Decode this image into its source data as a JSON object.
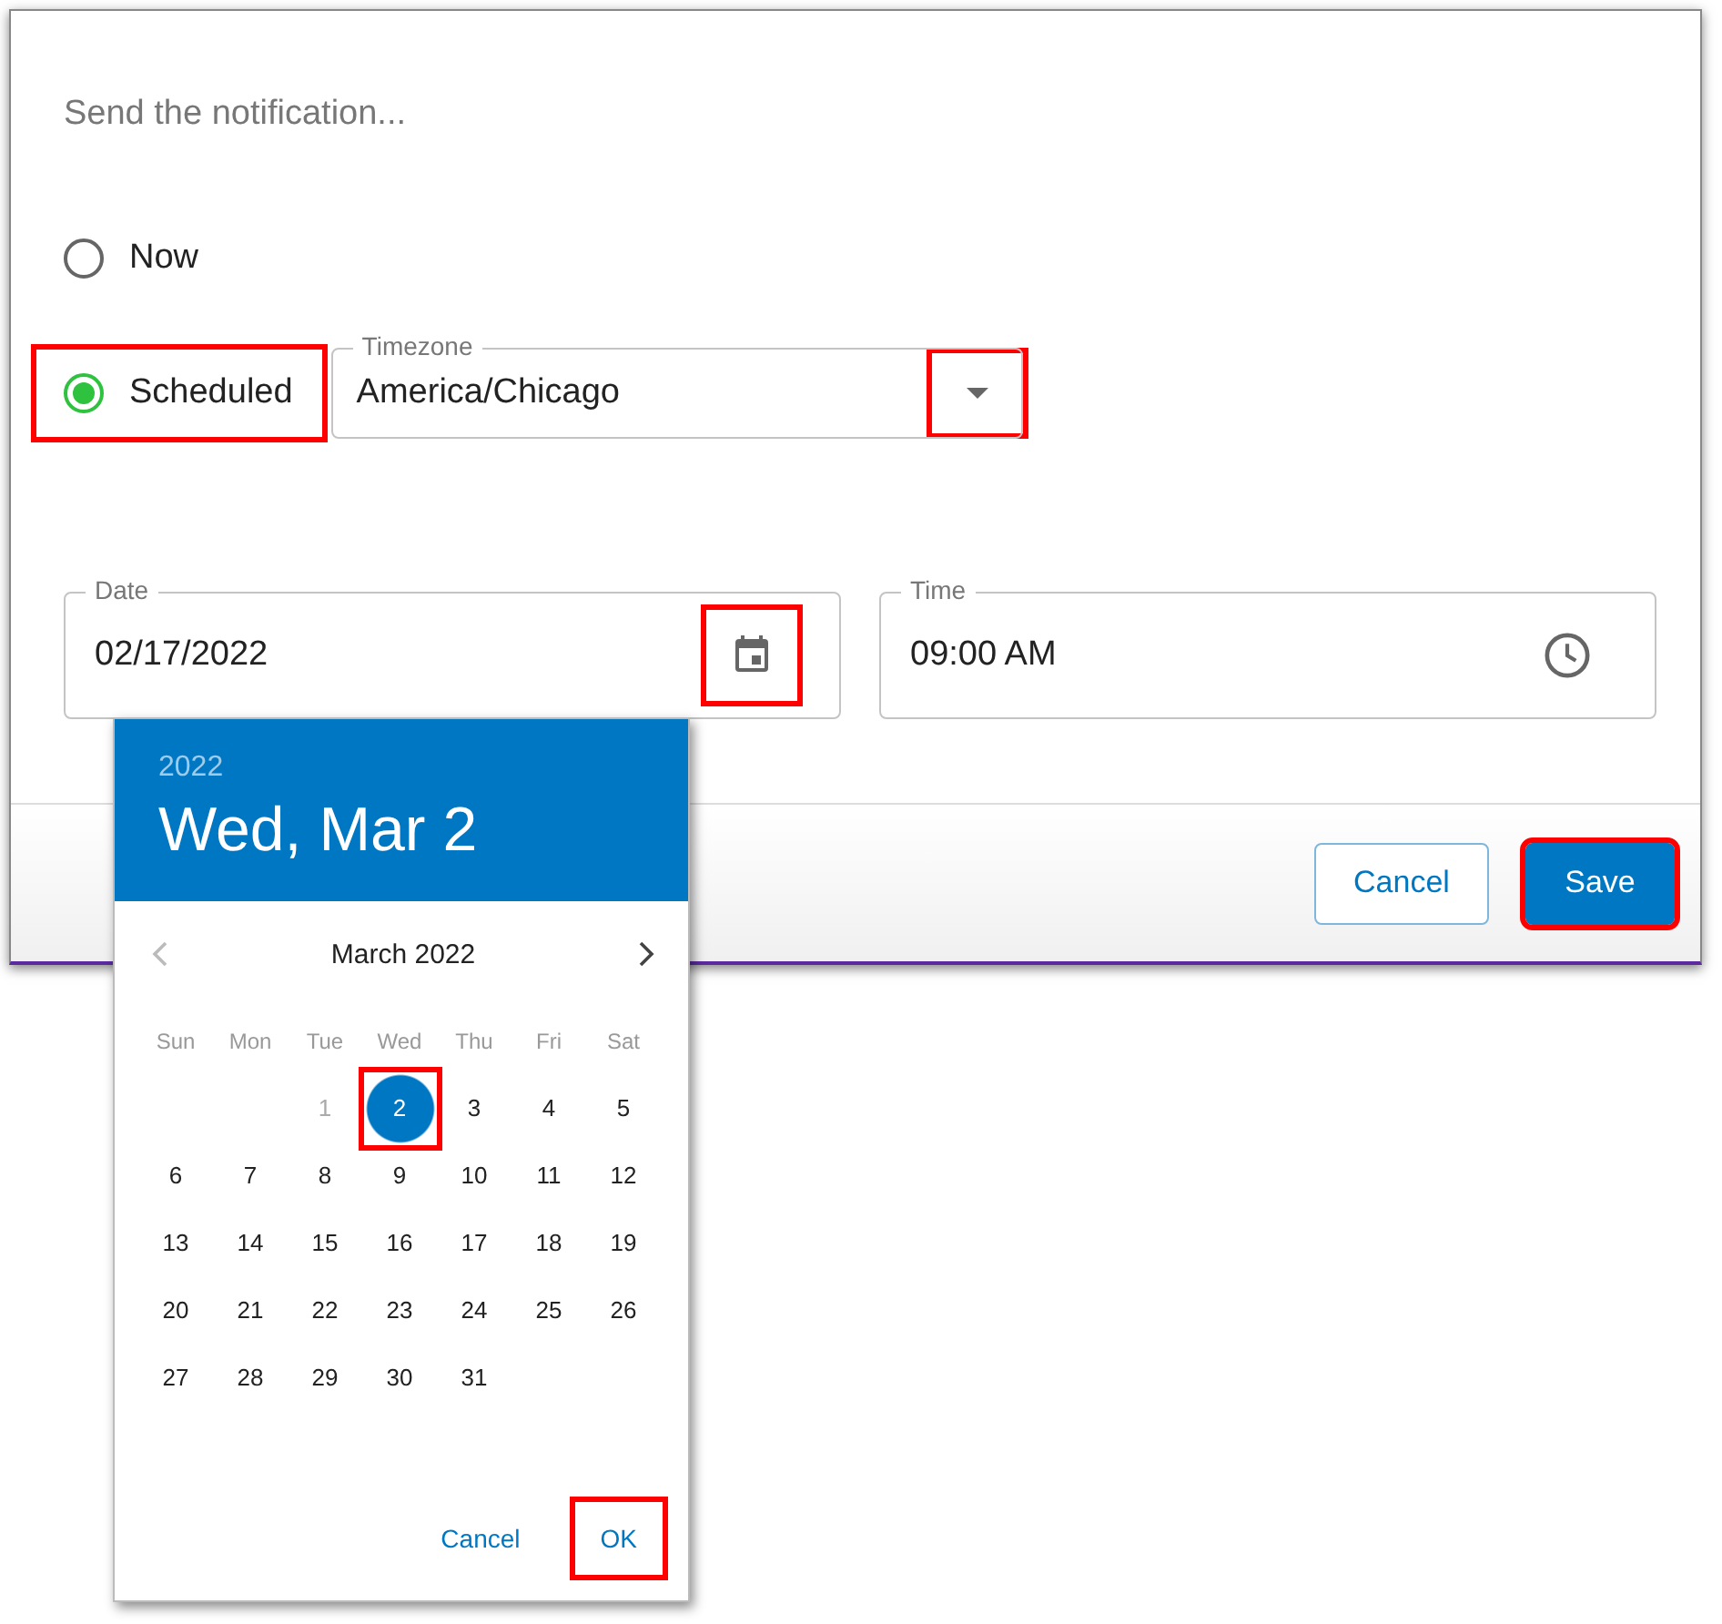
{
  "dialog": {
    "prompt": "Send the notification...",
    "options": [
      {
        "label": "Now",
        "selected": false,
        "highlighted": false
      },
      {
        "label": "Scheduled",
        "selected": true,
        "highlighted": true
      }
    ],
    "timezone": {
      "label": "Timezone",
      "value": "America/Chicago",
      "dropdown_highlighted": true
    },
    "date": {
      "label": "Date",
      "value": "02/17/2022",
      "icon_highlighted": true
    },
    "time": {
      "label": "Time",
      "value": "09:00 AM",
      "icon_highlighted": false
    },
    "buttons": [
      {
        "label": "Cancel",
        "kind": "outlined",
        "highlighted": false
      },
      {
        "label": "Save",
        "kind": "primary",
        "highlighted": true
      }
    ]
  },
  "date_picker": {
    "year": "2022",
    "selected_date": "Wed, Mar 2",
    "month": "March 2022",
    "prev_disabled": true,
    "weekdays": [
      "Sun",
      "Mon",
      "Tue",
      "Wed",
      "Thu",
      "Fri",
      "Sat"
    ],
    "weeks": [
      [
        {
          "kind": "blank"
        },
        {
          "kind": "blank"
        },
        {
          "kind": "day",
          "day": "1",
          "disabled": true,
          "selected": false,
          "highlighted": false
        },
        {
          "kind": "day",
          "day": "2",
          "disabled": false,
          "selected": true,
          "highlighted": true
        },
        {
          "kind": "day",
          "day": "3",
          "disabled": false,
          "selected": false,
          "highlighted": false
        },
        {
          "kind": "day",
          "day": "4",
          "disabled": false,
          "selected": false,
          "highlighted": false
        },
        {
          "kind": "day",
          "day": "5",
          "disabled": false,
          "selected": false,
          "highlighted": false
        }
      ],
      [
        {
          "kind": "day",
          "day": "6",
          "disabled": false,
          "selected": false,
          "highlighted": false
        },
        {
          "kind": "day",
          "day": "7",
          "disabled": false,
          "selected": false,
          "highlighted": false
        },
        {
          "kind": "day",
          "day": "8",
          "disabled": false,
          "selected": false,
          "highlighted": false
        },
        {
          "kind": "day",
          "day": "9",
          "disabled": false,
          "selected": false,
          "highlighted": false
        },
        {
          "kind": "day",
          "day": "10",
          "disabled": false,
          "selected": false,
          "highlighted": false
        },
        {
          "kind": "day",
          "day": "11",
          "disabled": false,
          "selected": false,
          "highlighted": false
        },
        {
          "kind": "day",
          "day": "12",
          "disabled": false,
          "selected": false,
          "highlighted": false
        }
      ],
      [
        {
          "kind": "day",
          "day": "13",
          "disabled": false,
          "selected": false,
          "highlighted": false
        },
        {
          "kind": "day",
          "day": "14",
          "disabled": false,
          "selected": false,
          "highlighted": false
        },
        {
          "kind": "day",
          "day": "15",
          "disabled": false,
          "selected": false,
          "highlighted": false
        },
        {
          "kind": "day",
          "day": "16",
          "disabled": false,
          "selected": false,
          "highlighted": false
        },
        {
          "kind": "day",
          "day": "17",
          "disabled": false,
          "selected": false,
          "highlighted": false
        },
        {
          "kind": "day",
          "day": "18",
          "disabled": false,
          "selected": false,
          "highlighted": false
        },
        {
          "kind": "day",
          "day": "19",
          "disabled": false,
          "selected": false,
          "highlighted": false
        }
      ],
      [
        {
          "kind": "day",
          "day": "20",
          "disabled": false,
          "selected": false,
          "highlighted": false
        },
        {
          "kind": "day",
          "day": "21",
          "disabled": false,
          "selected": false,
          "highlighted": false
        },
        {
          "kind": "day",
          "day": "22",
          "disabled": false,
          "selected": false,
          "highlighted": false
        },
        {
          "kind": "day",
          "day": "23",
          "disabled": false,
          "selected": false,
          "highlighted": false
        },
        {
          "kind": "day",
          "day": "24",
          "disabled": false,
          "selected": false,
          "highlighted": false
        },
        {
          "kind": "day",
          "day": "25",
          "disabled": false,
          "selected": false,
          "highlighted": false
        },
        {
          "kind": "day",
          "day": "26",
          "disabled": false,
          "selected": false,
          "highlighted": false
        }
      ],
      [
        {
          "kind": "day",
          "day": "27",
          "disabled": false,
          "selected": false,
          "highlighted": false
        },
        {
          "kind": "day",
          "day": "28",
          "disabled": false,
          "selected": false,
          "highlighted": false
        },
        {
          "kind": "day",
          "day": "29",
          "disabled": false,
          "selected": false,
          "highlighted": false
        },
        {
          "kind": "day",
          "day": "30",
          "disabled": false,
          "selected": false,
          "highlighted": false
        },
        {
          "kind": "day",
          "day": "31",
          "disabled": false,
          "selected": false,
          "highlighted": false
        }
      ]
    ],
    "actions": [
      {
        "label": "Cancel",
        "highlighted": false
      },
      {
        "label": "OK",
        "highlighted": true
      }
    ]
  }
}
